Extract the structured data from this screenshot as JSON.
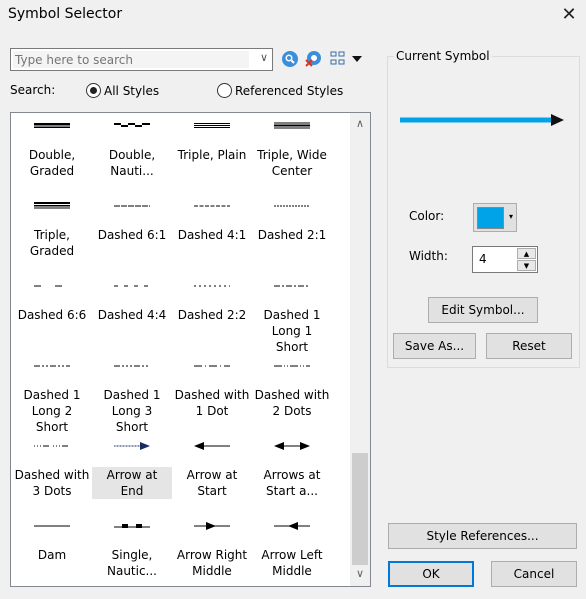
{
  "window": {
    "title": "Symbol Selector",
    "close": "✕"
  },
  "search": {
    "placeholder": "Type here to search",
    "value": "",
    "label": "Search:",
    "options": [
      {
        "label": "All Styles",
        "checked": true
      },
      {
        "label": "Referenced Styles",
        "checked": false
      }
    ],
    "icons": [
      "search-icon",
      "clear-search-icon",
      "view-toggle-icon"
    ]
  },
  "symbols": [
    {
      "label": "Double, Graded",
      "kind": "double-graded"
    },
    {
      "label": "Double, Nauti...",
      "kind": "double-nautical"
    },
    {
      "label": "Triple, Plain",
      "kind": "triple-plain"
    },
    {
      "label": "Triple, Wide Center",
      "kind": "triple-wide"
    },
    {
      "label": "Triple, Graded",
      "kind": "triple-graded"
    },
    {
      "label": "Dashed 6:1",
      "kind": "dash",
      "dash": "6 1"
    },
    {
      "label": "Dashed 4:1",
      "kind": "dash",
      "dash": "4 1.5"
    },
    {
      "label": "Dashed 2:1",
      "kind": "dash",
      "dash": "2 1"
    },
    {
      "label": "Dashed 6:6",
      "kind": "dash",
      "dash": "7 14"
    },
    {
      "label": "Dashed 4:4",
      "kind": "dash",
      "dash": "4 6"
    },
    {
      "label": "Dashed 2:2",
      "kind": "dash",
      "dash": "2 3"
    },
    {
      "label": "Dashed 1 Long 1 Short",
      "kind": "dash",
      "dash": "6 2 2 2"
    },
    {
      "label": "Dashed 1 Long 2 Short",
      "kind": "dash",
      "dash": "6 2 2 2 2 2"
    },
    {
      "label": "Dashed 1 Long 3 Short",
      "kind": "dash",
      "dash": "6 2 2 2 2 2 2 2"
    },
    {
      "label": "Dashed with 1 Dot",
      "kind": "dash",
      "dash": "8 3 1 3"
    },
    {
      "label": "Dashed with 2 Dots",
      "kind": "dash",
      "dash": "8 2 1 2 1 2"
    },
    {
      "label": "Dashed with 3 Dots",
      "kind": "dash",
      "dash": "1 2 1 2 1 2 6 4"
    },
    {
      "label": "Arrow at End",
      "kind": "arrow-end",
      "selected": true
    },
    {
      "label": "Arrow at Start",
      "kind": "arrow-start"
    },
    {
      "label": "Arrows at Start a...",
      "kind": "arrow-both"
    },
    {
      "label": "Dam",
      "kind": "solid"
    },
    {
      "label": "Single, Nautic...",
      "kind": "single-nautical"
    },
    {
      "label": "Arrow Right Middle",
      "kind": "arrow-right-mid"
    },
    {
      "label": "Arrow Left Middle",
      "kind": "arrow-left-mid"
    }
  ],
  "current": {
    "label": "Current Symbol",
    "color_label": "Color:",
    "color": "#00a2e8",
    "width_label": "Width:",
    "width": "4",
    "edit": "Edit Symbol...",
    "save_as": "Save As...",
    "reset": "Reset"
  },
  "footer": {
    "style_refs": "Style References...",
    "ok": "OK",
    "cancel": "Cancel"
  }
}
